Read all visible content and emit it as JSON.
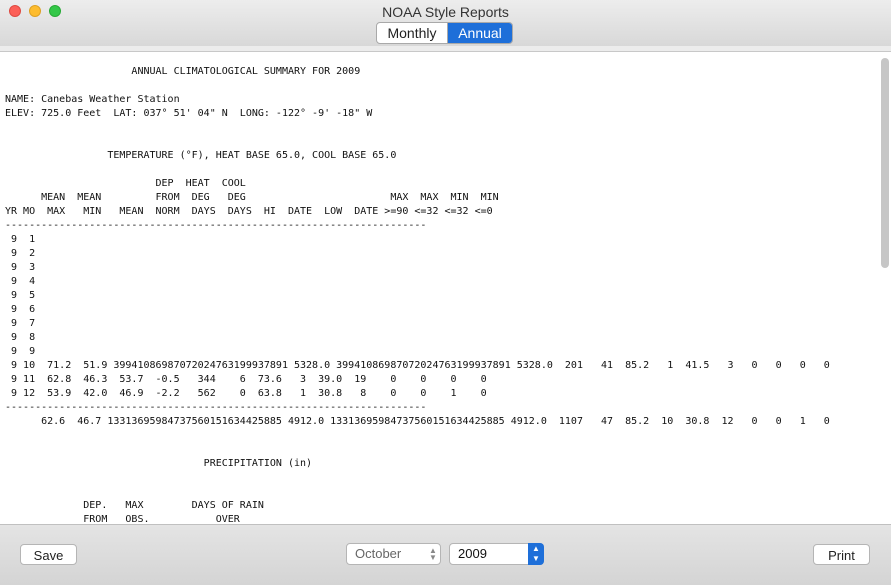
{
  "window": {
    "title": "NOAA Style Reports"
  },
  "tabs": {
    "monthly": "Monthly",
    "annual": "Annual"
  },
  "report": {
    "text": "                     ANNUAL CLIMATOLOGICAL SUMMARY FOR 2009\n\nNAME: Canebas Weather Station\nELEV: 725.0 Feet  LAT: 037° 51' 04\" N  LONG: -122° -9' -18\" W\n\n\n                 TEMPERATURE (°F), HEAT BASE 65.0, COOL BASE 65.0\n\n                         DEP  HEAT  COOL\n      MEAN  MEAN         FROM  DEG   DEG                        MAX  MAX  MIN  MIN\nYR MO  MAX   MIN   MEAN  NORM  DAYS  DAYS  HI  DATE  LOW  DATE >=90 <=32 <=32 <=0\n----------------------------------------------------------------------\n 9  1\n 9  2\n 9  3\n 9  4\n 9  5\n 9  6\n 9  7\n 9  8\n 9  9\n 9 10  71.2  51.9 39941086987072024763199937891 5328.0 39941086987072024763199937891 5328.0  201   41  85.2   1  41.5   3   0   0   0   0\n 9 11  62.8  46.3  53.7  -0.5   344    6  73.6   3  39.0  19    0    0    0    0\n 9 12  53.9  42.0  46.9  -2.2   562    0  63.8   1  30.8   8    0    0    1    0\n----------------------------------------------------------------------\n      62.6  46.7 13313695984737560151634425885 4912.0 13313695984737560151634425885 4912.0  1107   47  85.2  10  30.8  12   0   0   1   0\n\n\n                                 PRECIPITATION (in)\n\n\n             DEP.   MAX        DAYS OF RAIN\n             FROM   OBS.           OVER"
  },
  "toolbar": {
    "save_label": "Save",
    "print_label": "Print",
    "month_value": "October",
    "year_value": "2009"
  }
}
